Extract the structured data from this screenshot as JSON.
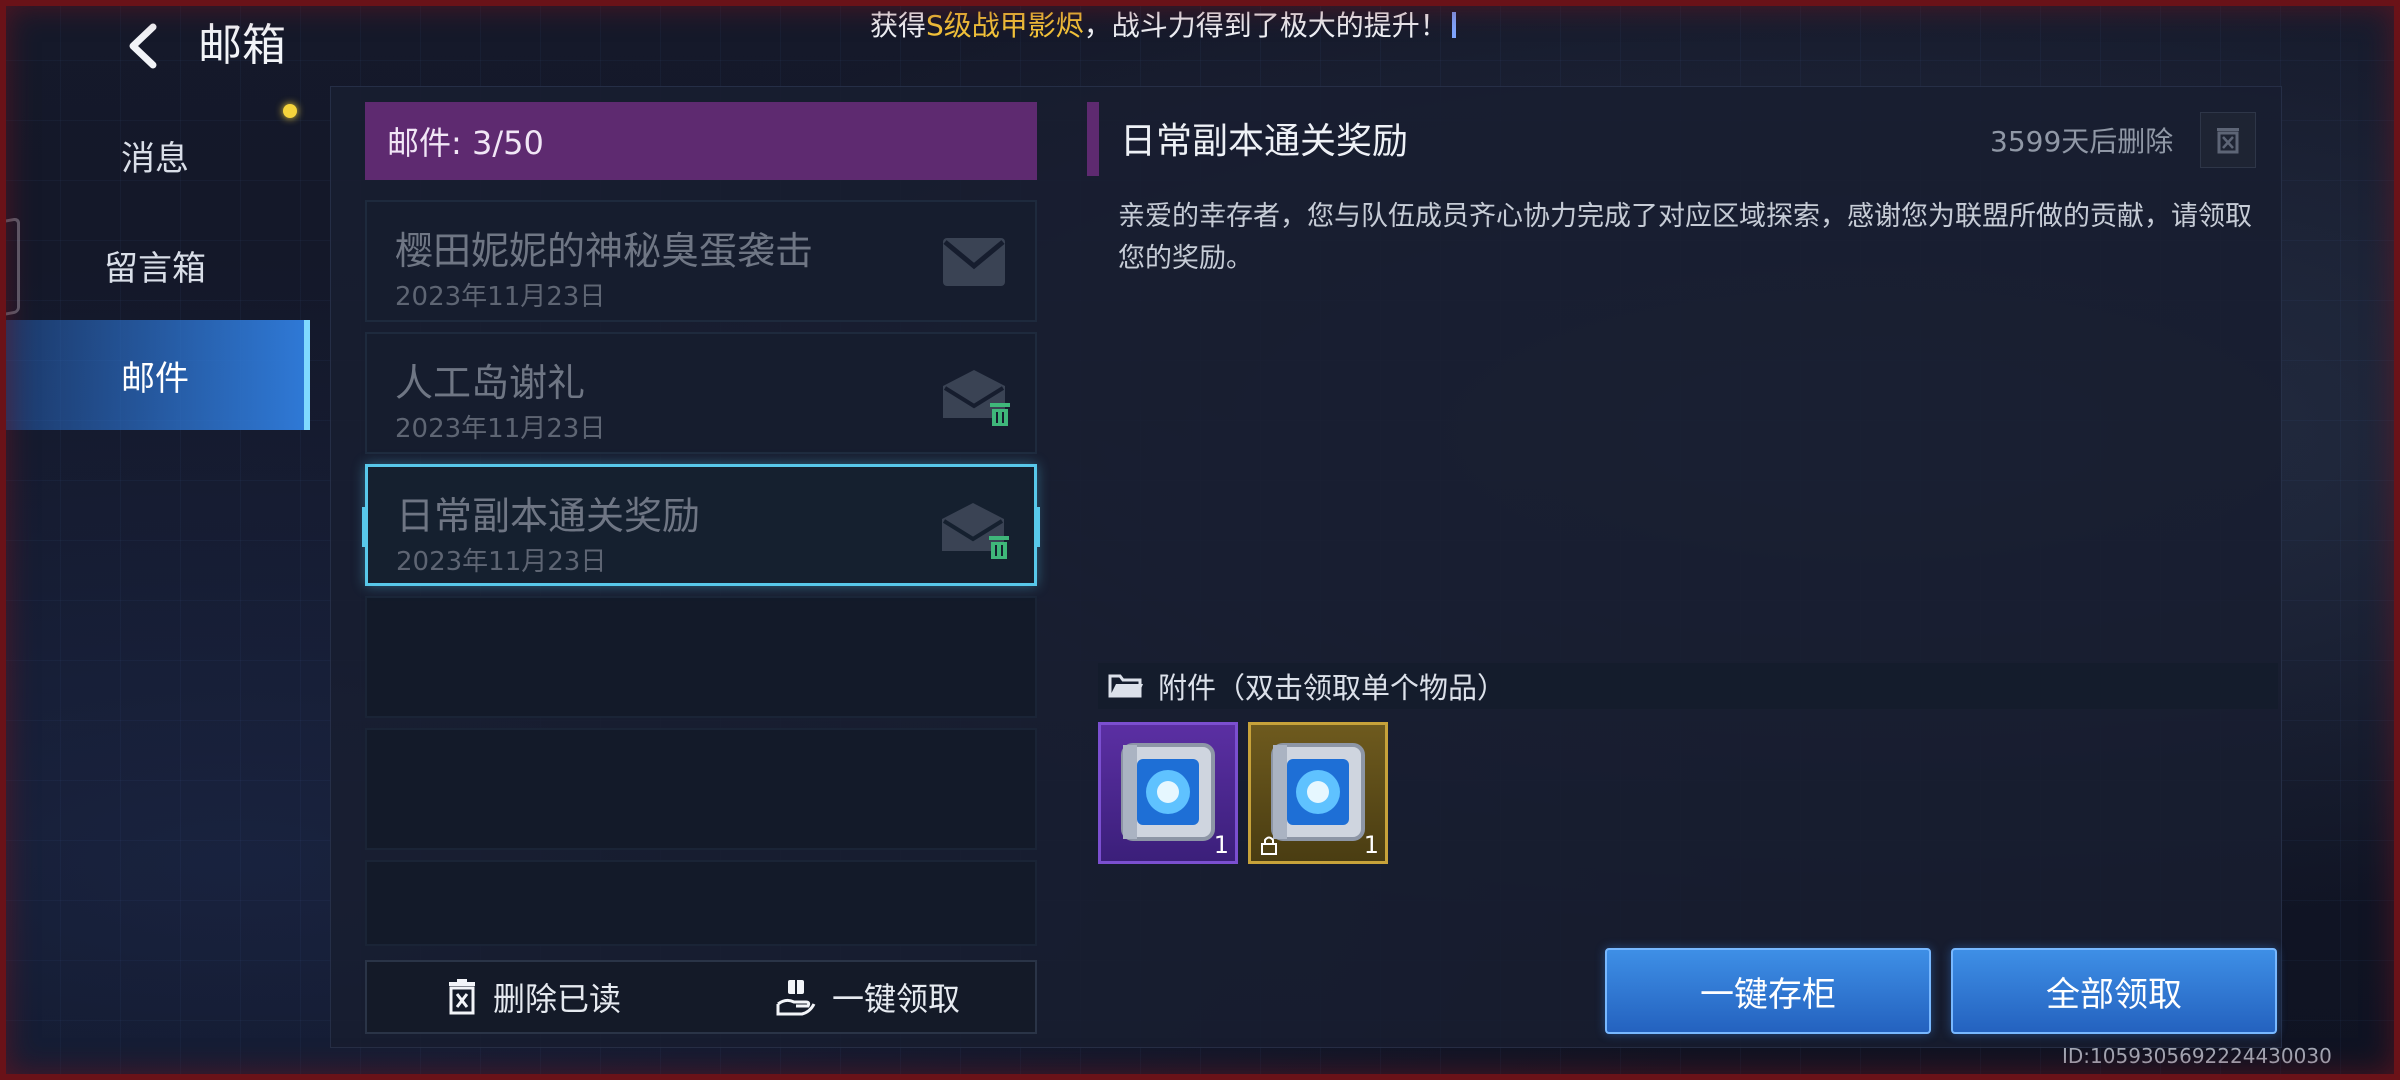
{
  "header": {
    "title": "邮箱",
    "ticker_prefix": "获得",
    "ticker_highlight": "S级战甲影烬",
    "ticker_suffix": "，战斗力得到了极大的提升！"
  },
  "nav": {
    "items": [
      {
        "label": "消息"
      },
      {
        "label": "留言箱"
      },
      {
        "label": "邮件"
      }
    ]
  },
  "mail_list": {
    "count_label": "邮件: 3/50",
    "items": [
      {
        "subject": "樱田妮妮的神秘臭蛋袭击",
        "date": "2023年11月23日"
      },
      {
        "subject": "人工岛谢礼",
        "date": "2023年11月23日"
      },
      {
        "subject": "日常副本通关奖励",
        "date": "2023年11月23日"
      }
    ],
    "delete_read_label": "删除已读",
    "claim_one_key_label": "一键领取"
  },
  "detail": {
    "title": "日常副本通关奖励",
    "expire_label": "3599天后删除",
    "body": "亲爱的幸存者，您与队伍成员齐心协力完成了对应区域探索，感谢您为联盟所做的贡献，请领取您的奖励。",
    "attachments_label": "附件（双击领取单个物品）",
    "attachments": [
      {
        "quantity": "1",
        "rarity": "purple"
      },
      {
        "quantity": "1",
        "rarity": "gold"
      }
    ],
    "store_all_label": "一键存柜",
    "claim_all_label": "全部领取"
  },
  "footer": {
    "uid": "ID:1059305692224430030"
  }
}
